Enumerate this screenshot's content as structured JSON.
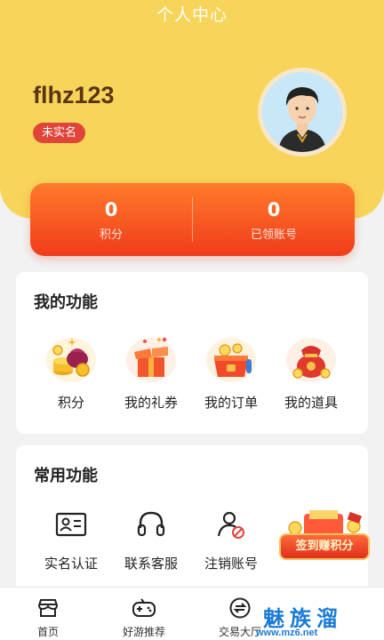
{
  "header": {
    "title": "个人中心"
  },
  "profile": {
    "username": "flhz123",
    "verify_status": "未实名"
  },
  "stats": [
    {
      "value": "0",
      "label": "积分"
    },
    {
      "value": "0",
      "label": "已领账号"
    }
  ],
  "my_functions": {
    "title": "我的功能",
    "items": [
      {
        "label": "积分",
        "icon": "coins-icon"
      },
      {
        "label": "我的礼券",
        "icon": "gift-box-icon"
      },
      {
        "label": "我的订单",
        "icon": "order-box-icon"
      },
      {
        "label": "我的道具",
        "icon": "treasure-bag-icon"
      }
    ]
  },
  "common_functions": {
    "title": "常用功能",
    "items": [
      {
        "label": "实名认证",
        "icon": "id-card-icon"
      },
      {
        "label": "联系客服",
        "icon": "headset-icon"
      },
      {
        "label": "注销账号",
        "icon": "user-cancel-icon"
      }
    ]
  },
  "float_promo": {
    "label": "签到赚积分"
  },
  "tabbar": {
    "items": [
      {
        "label": "首页",
        "icon": "store-icon"
      },
      {
        "label": "好游推荐",
        "icon": "gamepad-icon"
      },
      {
        "label": "交易大厅",
        "icon": "exchange-icon"
      }
    ]
  },
  "watermark": {
    "text": "魅族溜",
    "url": "www.mz6.net"
  },
  "colors": {
    "header_bg": "#f7d45a",
    "stats_gradient_top": "#ff7b2a",
    "stats_gradient_bottom": "#f03c1c",
    "badge_red": "#e0453a"
  }
}
